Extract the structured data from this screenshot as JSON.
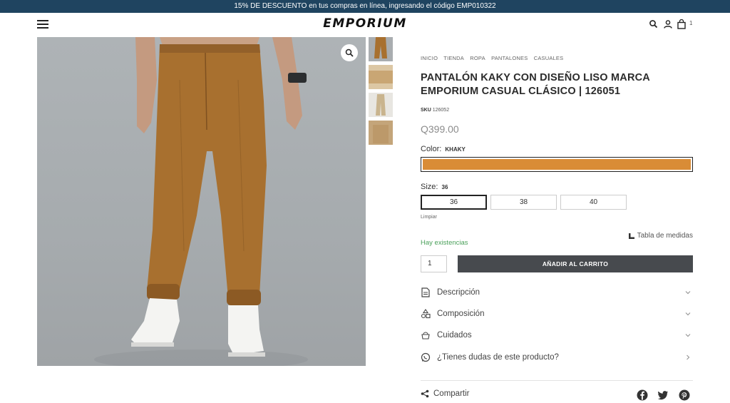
{
  "promo": {
    "text": "15% DE DESCUENTO en tus compras en línea, ingresando el código EMP010322"
  },
  "header": {
    "logo": "EMPORIUM",
    "cart_count": "1"
  },
  "breadcrumb": [
    "INICIO",
    "TIENDA",
    "ROPA",
    "PANTALONES",
    "CASUALES"
  ],
  "product": {
    "title": "PANTALÓN KAKY CON DISEÑO LISO MARCA EMPORIUM CASUAL CLÁSICO | 126051",
    "sku_label": "SKU",
    "sku_value": "126052",
    "price": "Q399.00",
    "color_label": "Color:",
    "color_value": "KHAKY",
    "color_hex": "#d98c36",
    "size_label": "Size:",
    "size_value": "36",
    "sizes": [
      "36",
      "38",
      "40"
    ],
    "clear_label": "Limpiar",
    "size_guide_label": "Tabla de medidas",
    "stock_text": "Hay existencias",
    "quantity": "1",
    "add_to_cart_label": "AÑADIR AL CARRITO"
  },
  "accordion": {
    "description": "Descripción",
    "composition": "Composición",
    "care": "Cuidados",
    "questions": "¿Tienes dudas de este producto?"
  },
  "share": {
    "label": "Compartir"
  },
  "icons": [
    "menu-icon",
    "search-icon",
    "user-icon",
    "cart-icon",
    "zoom-icon",
    "ruler-icon",
    "document-icon",
    "shapes-icon",
    "care-icon",
    "whatsapp-icon",
    "chevron-down-icon",
    "chevron-right-icon",
    "share-icon",
    "facebook-icon",
    "twitter-icon",
    "pinterest-icon"
  ],
  "colors": {
    "promo_bg": "#1f4460",
    "cta_bg": "#474a4e",
    "stock_green": "#4aa05a",
    "khaki": "#d98c36"
  }
}
